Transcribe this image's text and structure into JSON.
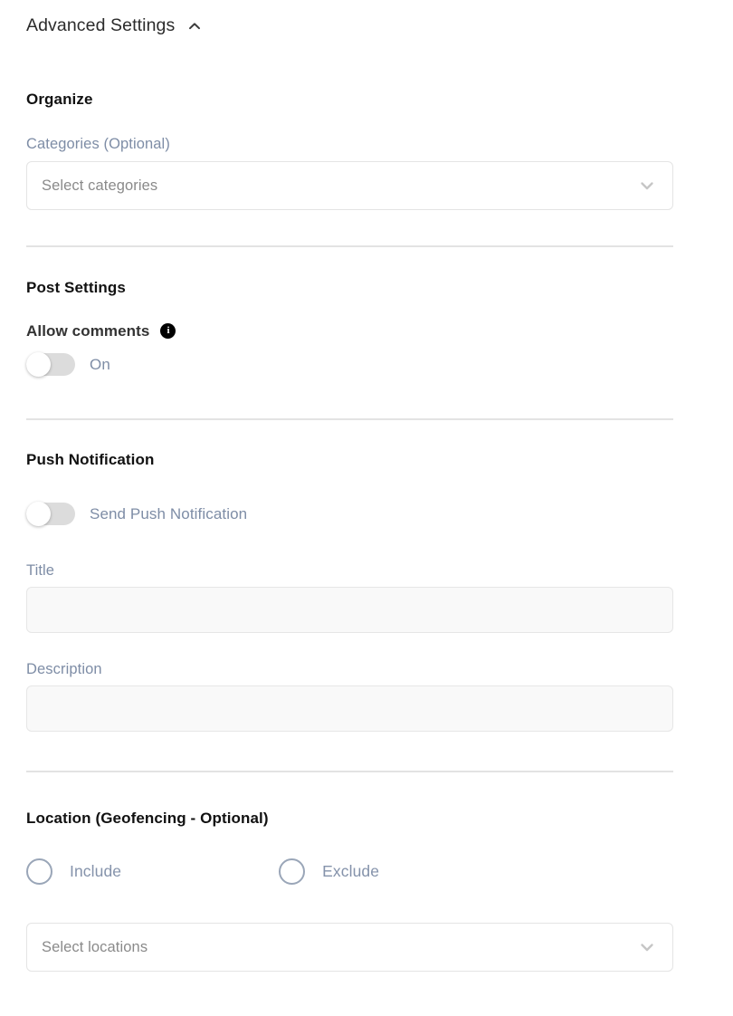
{
  "panel": {
    "title": "Advanced Settings",
    "collapse_icon": "chevron-up-icon"
  },
  "organize": {
    "heading": "Organize",
    "categories_label": "Categories (Optional)",
    "categories_placeholder": "Select categories",
    "categories_value": "",
    "dropdown_icon": "chevron-down-icon"
  },
  "post_settings": {
    "heading": "Post Settings",
    "allow_comments_label": "Allow comments",
    "info_icon": "info-icon",
    "info_glyph": "i",
    "allow_comments_state_label": "On",
    "allow_comments_on": false
  },
  "push_notification": {
    "heading": "Push Notification",
    "send_toggle_label": "Send Push Notification",
    "send_toggle_on": false,
    "title_label": "Title",
    "title_value": "",
    "title_placeholder": "",
    "description_label": "Description",
    "description_value": "",
    "description_placeholder": ""
  },
  "location": {
    "heading": "Location (Geofencing - Optional)",
    "include_label": "Include",
    "exclude_label": "Exclude",
    "include_selected": false,
    "exclude_selected": false,
    "locations_placeholder": "Select locations",
    "locations_value": "",
    "dropdown_icon": "chevron-down-icon"
  },
  "colors": {
    "label_blue_gray": "#7e8da6",
    "heading_dark": "#111111",
    "toggle_track": "#dcdcdc",
    "border_light": "#e4e4e4",
    "input_fill": "#f9f9f9",
    "divider": "#e3e3e3",
    "radio_border": "#9aa6b8"
  }
}
